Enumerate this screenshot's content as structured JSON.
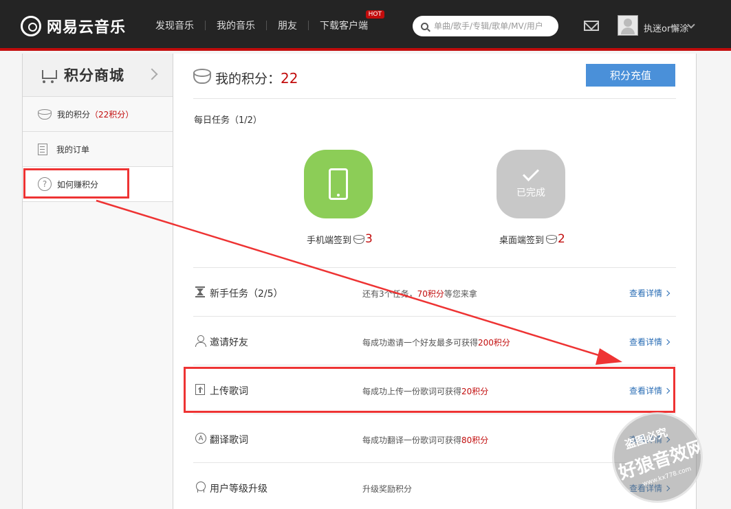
{
  "header": {
    "logo_text": "网易云音乐",
    "nav": [
      "发现音乐",
      "我的音乐",
      "朋友",
      "下载客户端"
    ],
    "hot_badge": "HOT",
    "search_placeholder": "单曲/歌手/专辑/歌单/MV/用户",
    "username": "执迷or懈涂",
    "accent_color": "#c20c0c"
  },
  "sidebar": {
    "title": "积分商城",
    "items": [
      {
        "label": "我的积分",
        "extra": "（22积分）",
        "icon": "coins-icon"
      },
      {
        "label": "我的订单",
        "icon": "doc-icon"
      },
      {
        "label": "如何赚积分",
        "icon": "question-icon"
      }
    ]
  },
  "main": {
    "title_label": "我的积分：",
    "points": "22",
    "recharge_label": "积分充值",
    "daily_label": "每日任务（1/2）",
    "daily_tasks": [
      {
        "caption": "手机端签到",
        "points": "3",
        "color": "#8ccd57"
      },
      {
        "caption": "桌面端签到",
        "points": "2",
        "status": "已完成",
        "color": "#c8c8c8"
      }
    ],
    "rows": [
      {
        "name": "新手任务（2/5）",
        "desc_pre": "还有3个任务，",
        "desc_red": "70积分",
        "desc_post": "等您来拿",
        "link": "查看详情",
        "icon": "hourglass-icon"
      },
      {
        "name": "邀请好友",
        "desc_pre": "每成功邀请一个好友最多可获得",
        "desc_red": "200积分",
        "desc_post": "",
        "link": "查看详情",
        "icon": "user-icon"
      },
      {
        "name": "上传歌词",
        "desc_pre": "每成功上传一份歌词可获得",
        "desc_red": "20积分",
        "desc_post": "",
        "link": "查看详情",
        "icon": "upload-icon"
      },
      {
        "name": "翻译歌词",
        "desc_pre": "每成功翻译一份歌词可获得",
        "desc_red": "80积分",
        "desc_post": "",
        "link": "查看详情",
        "icon": "translate-icon"
      },
      {
        "name": "用户等级升级",
        "desc_pre": "升级奖励积分",
        "desc_red": "",
        "desc_post": "",
        "link": "查看详情",
        "icon": "level-icon"
      }
    ]
  },
  "watermark": {
    "top": "盗图必究",
    "main": "好狼音效网",
    "url": "www.kx778.com"
  },
  "annotation_color": "#ee3333"
}
